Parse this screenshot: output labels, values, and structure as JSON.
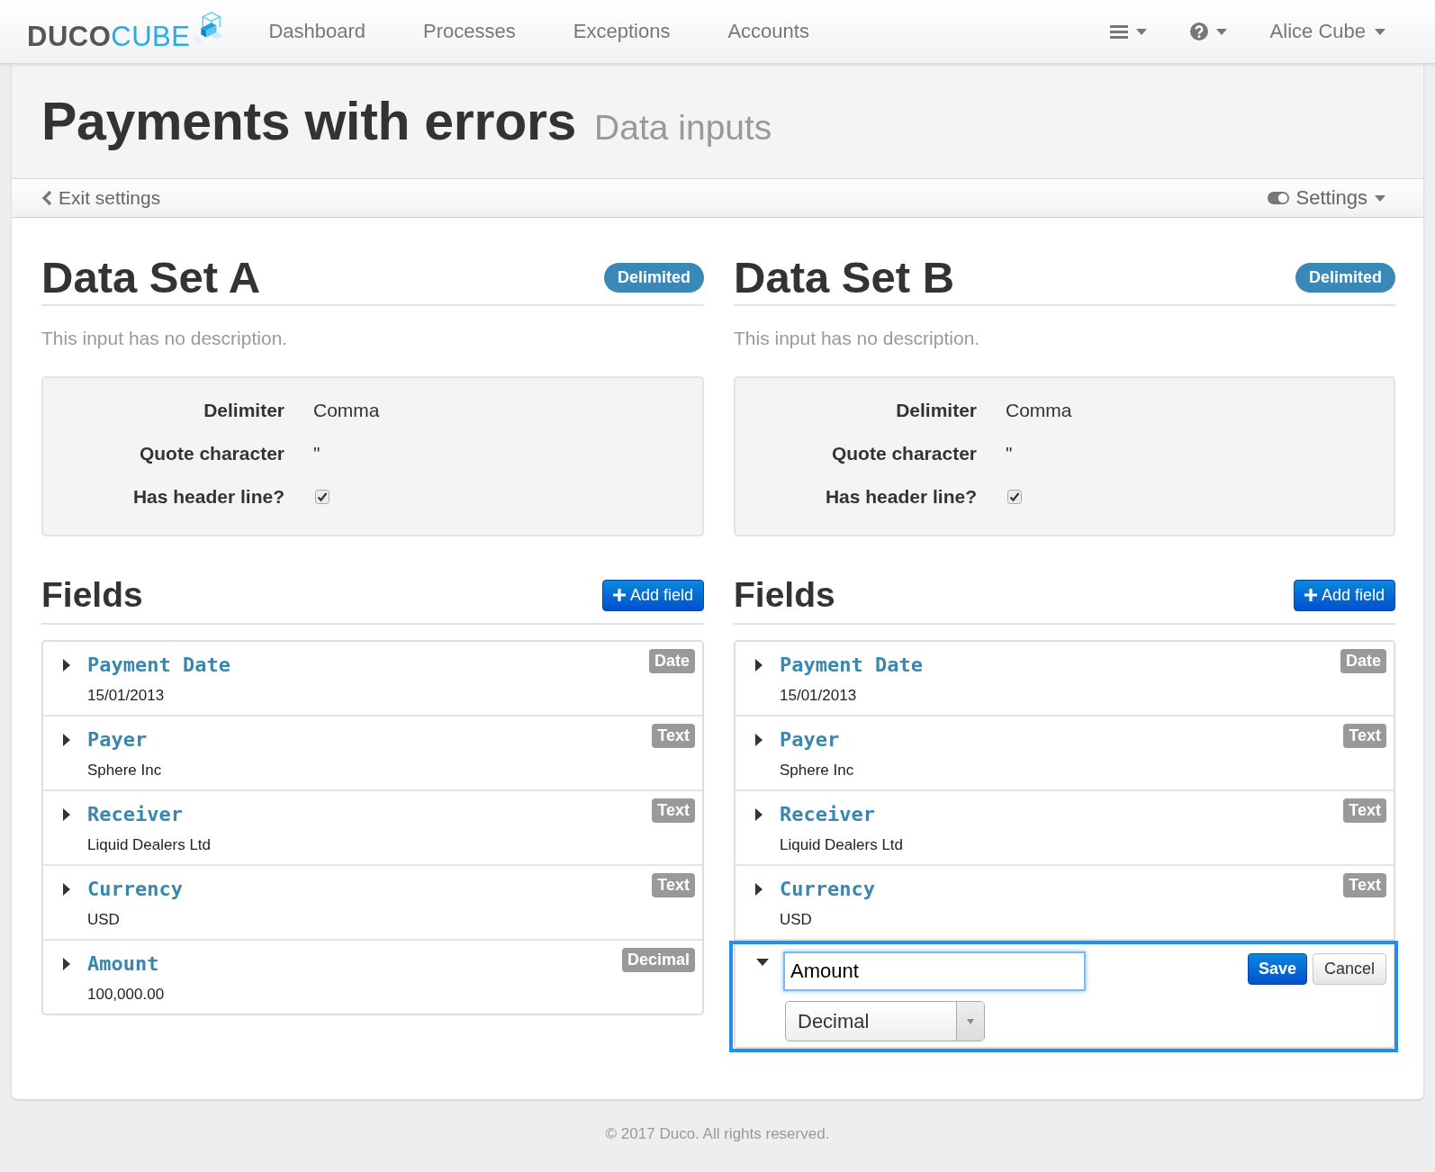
{
  "navbar": {
    "brand": {
      "dark_part": "DUCO",
      "light_part": "CUBE"
    },
    "nav_items": [
      {
        "label": "Dashboard",
        "selected": false
      },
      {
        "label": "Processes",
        "selected": false
      },
      {
        "label": "Exceptions",
        "selected": false
      },
      {
        "label": "Accounts",
        "selected": false
      }
    ],
    "user_menu": "Alice Cube"
  },
  "page_header": {
    "title": "Payments with errors",
    "subtitle": "Data inputs"
  },
  "settings_bar": {
    "back_link": "Exit settings",
    "settings_menu": "Settings"
  },
  "data_sets": [
    {
      "title": "Data Set A",
      "format_badge": "Delimited",
      "description": "This input has no description.",
      "properties": [
        {
          "kind": "text",
          "label": "Delimiter",
          "value": "Comma"
        },
        {
          "kind": "text",
          "label": "Quote character",
          "value": "\""
        },
        {
          "kind": "checkbox",
          "label": "Has header line?",
          "checked": true
        }
      ],
      "fields_title": "Fields",
      "add_field_button": "Add field",
      "fields": [
        {
          "kind": "display",
          "expanded": false,
          "name": "Payment Date",
          "value": "15/01/2013",
          "type": "Date"
        },
        {
          "kind": "display",
          "expanded": false,
          "name": "Payer",
          "value": "Sphere Inc",
          "type": "Text"
        },
        {
          "kind": "display",
          "expanded": false,
          "name": "Receiver",
          "value": "Liquid Dealers Ltd",
          "type": "Text"
        },
        {
          "kind": "display",
          "expanded": false,
          "name": "Currency",
          "value": "USD",
          "type": "Text"
        },
        {
          "kind": "display",
          "expanded": false,
          "name": "Amount",
          "value": "100,000.00",
          "type": "Decimal"
        }
      ]
    },
    {
      "title": "Data Set B",
      "format_badge": "Delimited",
      "description": "This input has no description.",
      "properties": [
        {
          "kind": "text",
          "label": "Delimiter",
          "value": "Comma"
        },
        {
          "kind": "text",
          "label": "Quote character",
          "value": "\""
        },
        {
          "kind": "checkbox",
          "label": "Has header line?",
          "checked": true
        }
      ],
      "fields_title": "Fields",
      "add_field_button": "Add field",
      "fields": [
        {
          "kind": "display",
          "expanded": false,
          "name": "Payment Date",
          "value": "15/01/2013",
          "type": "Date"
        },
        {
          "kind": "display",
          "expanded": false,
          "name": "Payer",
          "value": "Sphere Inc",
          "type": "Text"
        },
        {
          "kind": "display",
          "expanded": false,
          "name": "Receiver",
          "value": "Liquid Dealers Ltd",
          "type": "Text"
        },
        {
          "kind": "display",
          "expanded": false,
          "name": "Currency",
          "value": "USD",
          "type": "Text"
        },
        {
          "kind": "edit",
          "expanded": true,
          "name_input": "Amount",
          "type_select": "Decimal",
          "save_button": "Save",
          "cancel_button": "Cancel"
        }
      ]
    }
  ],
  "footer": {
    "copyright": "© 2017 Duco. All rights reserved."
  }
}
